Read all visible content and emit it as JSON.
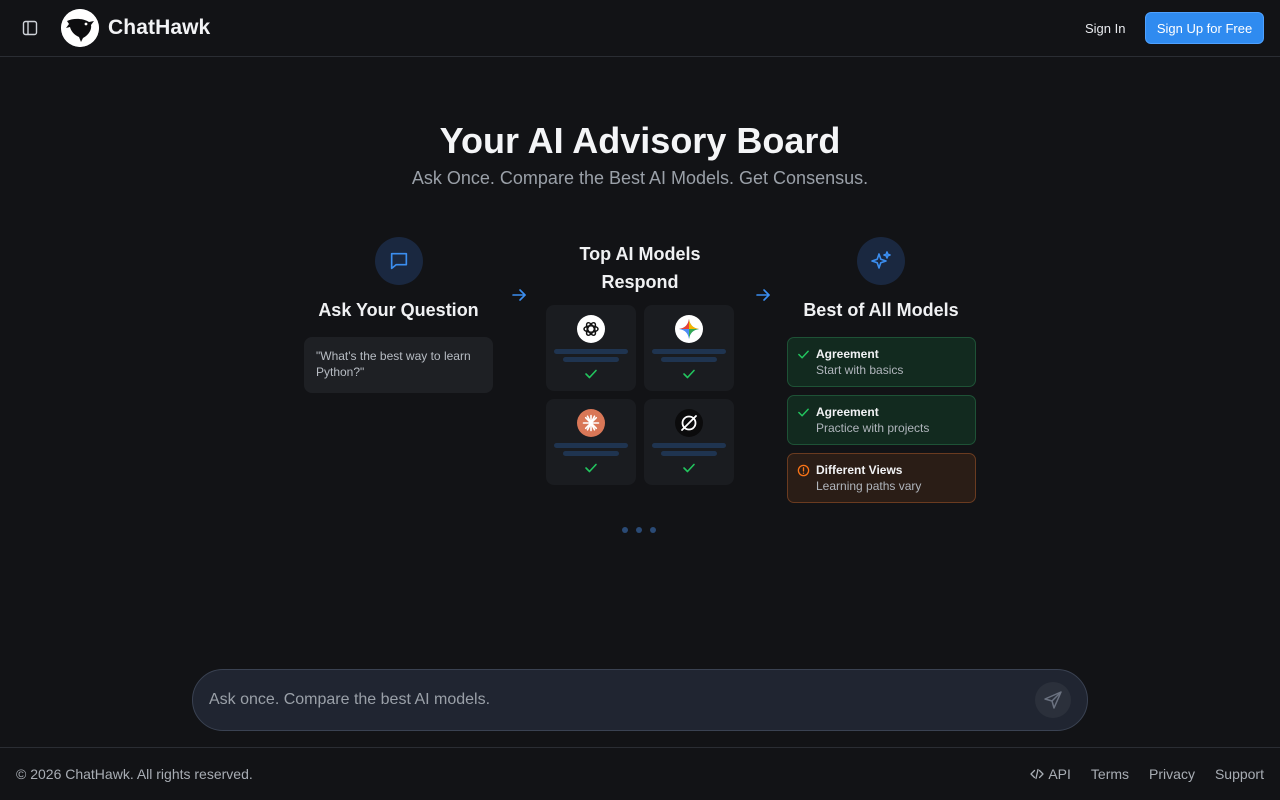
{
  "header": {
    "brand": "ChatHawk",
    "signin_label": "Sign In",
    "signup_label": "Sign Up for Free"
  },
  "hero": {
    "title": "Your AI Advisory Board",
    "subtitle": "Ask Once. Compare the Best AI Models. Get Consensus."
  },
  "steps": {
    "ask": {
      "title": "Ask Your Question",
      "question": "\"What's the best way to learn Python?\""
    },
    "respond": {
      "title_line1": "Top AI Models",
      "title_line2": "Respond"
    },
    "best": {
      "title": "Best of All Models"
    }
  },
  "models": [
    {
      "icon": "openai-icon"
    },
    {
      "icon": "gemini-icon"
    },
    {
      "icon": "claude-icon"
    },
    {
      "icon": "grok-icon"
    }
  ],
  "results": [
    {
      "type": "agreement",
      "title": "Agreement",
      "desc": "Start with basics"
    },
    {
      "type": "agreement",
      "title": "Agreement",
      "desc": "Practice with projects"
    },
    {
      "type": "different",
      "title": "Different Views",
      "desc": "Learning paths vary"
    }
  ],
  "input": {
    "placeholder": "Ask once. Compare the best AI models."
  },
  "footer": {
    "copyright": "© 2026 ChatHawk. All rights reserved.",
    "links": [
      "API",
      "Terms",
      "Privacy",
      "Support"
    ]
  },
  "colors": {
    "accent": "#2f8bf0",
    "agree": "#22c55e",
    "different": "#f97316",
    "background": "#121316"
  }
}
